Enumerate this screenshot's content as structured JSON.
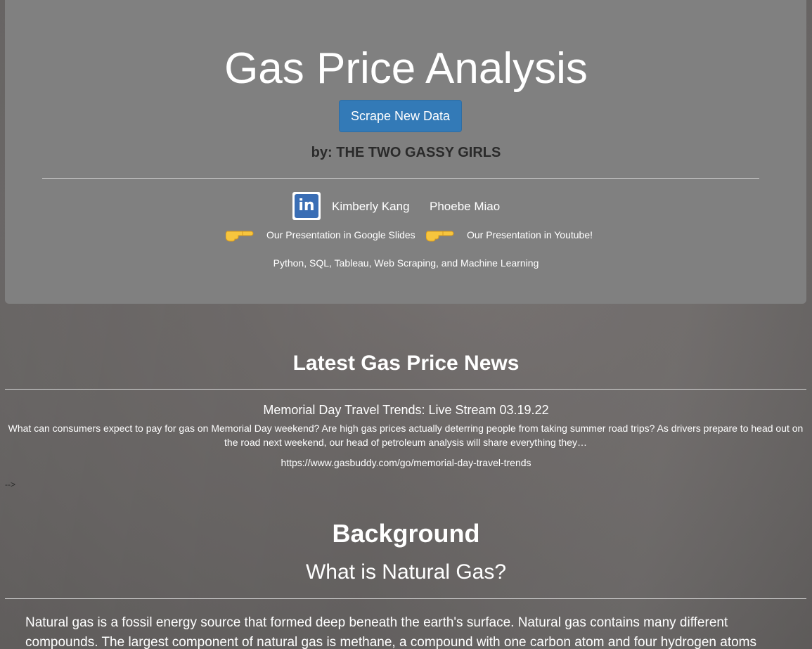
{
  "header": {
    "title": "Gas Price Analysis",
    "scrape_button": "Scrape New Data",
    "byline": "by: THE TWO GASSY GIRLS",
    "authors": [
      "Kimberly Kang",
      "Phoebe Miao"
    ],
    "links": {
      "google_slides": "Our Presentation in Google Slides",
      "youtube": "Our Presentation in Youtube!"
    },
    "skills": "Python, SQL, Tableau, Web Scraping, and Machine Learning"
  },
  "news": {
    "heading": "Latest Gas Price News",
    "article_title": "Memorial Day Travel Trends: Live Stream 03.19.22",
    "article_body": "What can consumers expect to pay for gas on Memorial Day weekend? Are high gas prices actually deterring people from taking summer road trips? As drivers prepare to head out on the road next weekend, our head of petroleum analysis will share everything they…",
    "article_url": "https://www.gasbuddy.com/go/memorial-day-travel-trends",
    "stray_text": "-->"
  },
  "background": {
    "heading": "Background",
    "subheading": "What is Natural Gas?",
    "paragraph": "Natural gas is a fossil energy source that formed deep beneath the earth's surface. Natural gas contains many different compounds. The largest component of natural gas is methane, a compound with one carbon atom and four hydrogen atoms"
  },
  "icons": {
    "linkedin": "linkedin-icon",
    "pointing_hand": "pointing-hand-icon"
  },
  "colors": {
    "jumbotron": "#808080",
    "button": "#337ab7",
    "byline": "#2a2a2a",
    "linkedin": "#3a6eb5",
    "hand": "#f7c53d"
  }
}
